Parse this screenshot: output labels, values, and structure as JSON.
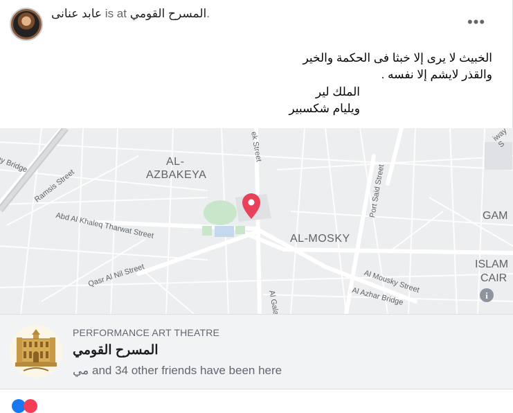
{
  "header": {
    "name": "عابد عنانى",
    "at": "is at",
    "place": "المسرح القومي",
    "dot": "."
  },
  "more_icon": "more-horizontal-icon",
  "post": {
    "line1": "الخبيث لا يرى إلا خبثا فى الحكمة والخير",
    "line2": "والقذر لايشم إلا نفسه .",
    "line3": "الملك لير",
    "line4": "ويليام شكسبير"
  },
  "map": {
    "labels": {
      "azbakeya1": "AL-",
      "azbakeya2": "AZBAKEYA",
      "mosky": "AL-MOSKY",
      "gam": "GAM",
      "islam1": "ISLAM",
      "islam2": "CAIR",
      "ramsis_bridge": "ay Bridge",
      "ramsis_street": "Ramsis Street",
      "tahrwat": "Abd Al Khaleq Tharwat Street",
      "qasr": "Qasr Al Nil Street",
      "port_said": "Port Said Street",
      "mousky": "Al Mousky Street",
      "azhar_bridge": "Al Azhar Bridge",
      "galaa": "Al Galaa",
      "ek_street": "ek Street",
      "way_top": "iway S"
    },
    "pin_color": "#e8415a"
  },
  "place": {
    "category": "PERFORMANCE ART THEATRE",
    "name": "المسرح القومي",
    "friends": "مي and 34 other friends have been here"
  }
}
